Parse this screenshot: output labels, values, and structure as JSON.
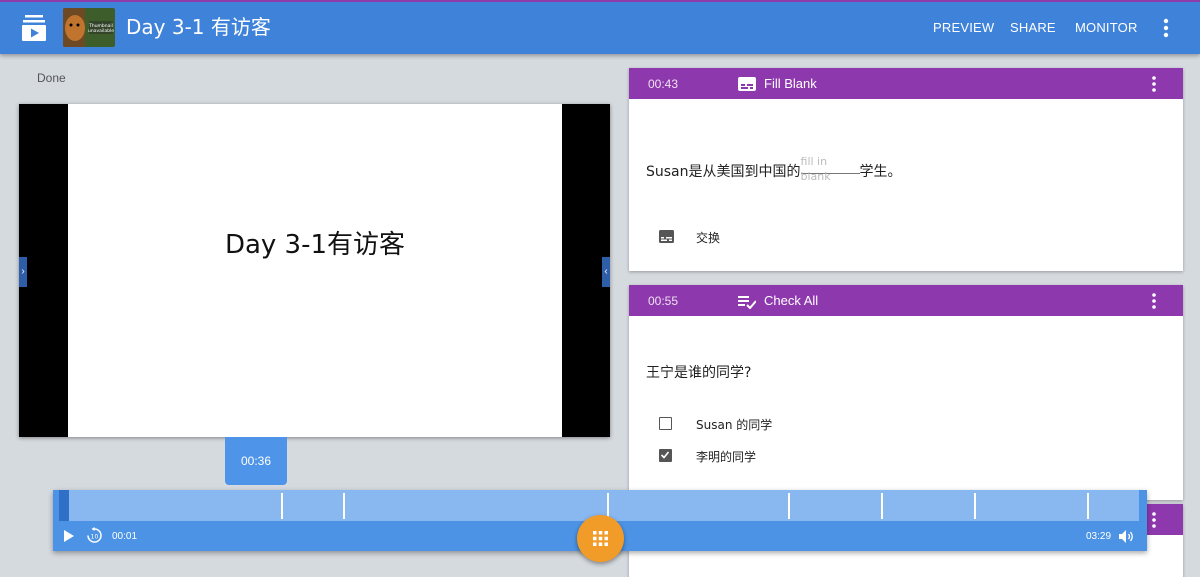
{
  "header": {
    "title": "Day 3-1 有访客",
    "thumbnail_text": "Thumbnail unavailable",
    "nav": [
      "PREVIEW",
      "SHARE",
      "MONITOR"
    ]
  },
  "left": {
    "status": "Done",
    "slide_title": "Day 3-1有访客",
    "current_time": "00:36"
  },
  "cards": [
    {
      "time": "00:43",
      "type": "Fill Blank",
      "question_before": "Susan是从美国到中国的",
      "blank_placeholder": "fill in blank",
      "question_after": "学生。",
      "option": "交换"
    },
    {
      "time": "00:55",
      "type": "Check All",
      "question": "王宁是谁的同学?",
      "options": [
        {
          "label": "Susan 的同学",
          "checked": false
        },
        {
          "label": "李明的同学",
          "checked": true
        }
      ]
    }
  ],
  "timeline": {
    "elapsed": "00:01",
    "duration": "03:29",
    "markers_seconds": [
      43,
      55,
      106,
      141,
      159,
      177,
      199
    ]
  },
  "colors": {
    "header_blue": "#3f82d9",
    "card_purple": "#8e38ad",
    "timeline_blue": "#4c93e6",
    "fab_orange": "#f19c28"
  }
}
